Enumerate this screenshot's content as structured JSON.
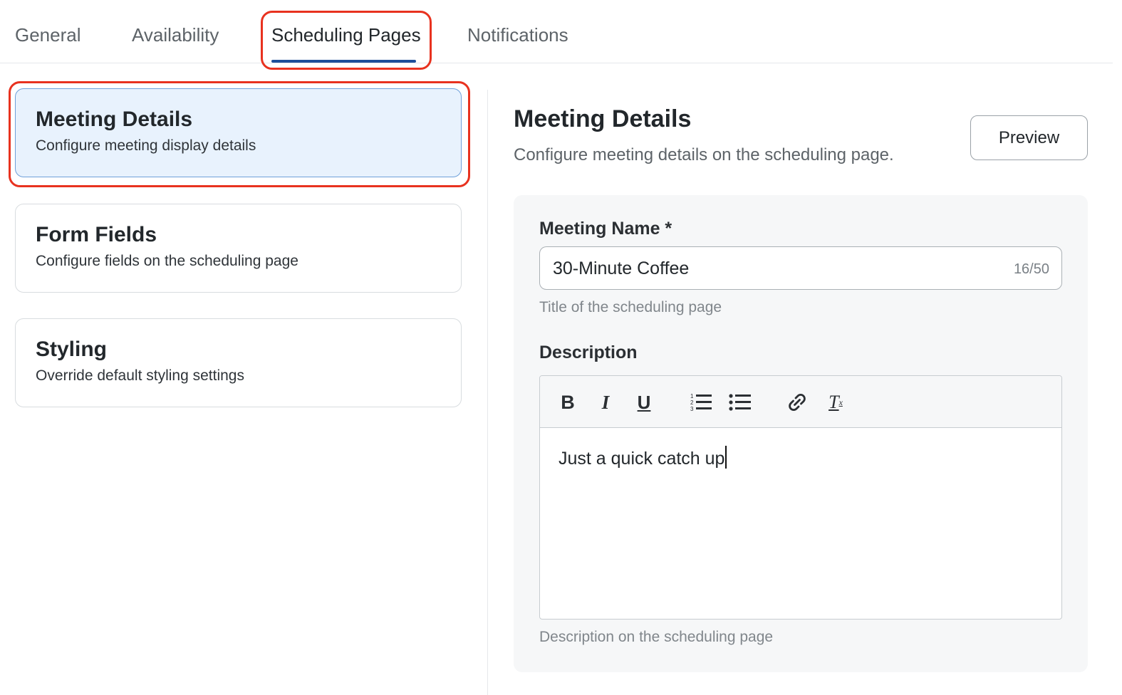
{
  "tabs": [
    {
      "label": "General",
      "active": false
    },
    {
      "label": "Availability",
      "active": false
    },
    {
      "label": "Scheduling Pages",
      "active": true
    },
    {
      "label": "Notifications",
      "active": false
    }
  ],
  "sections": [
    {
      "title": "Meeting Details",
      "subtitle": "Configure meeting display details",
      "selected": true
    },
    {
      "title": "Form Fields",
      "subtitle": "Configure fields on the scheduling page",
      "selected": false
    },
    {
      "title": "Styling",
      "subtitle": "Override default styling settings",
      "selected": false
    }
  ],
  "main": {
    "title": "Meeting Details",
    "subtitle": "Configure meeting details on the scheduling page.",
    "preview_label": "Preview",
    "meeting_name": {
      "label": "Meeting Name *",
      "value": "30-Minute Coffee",
      "counter": "16/50",
      "helper": "Title of the scheduling page"
    },
    "description": {
      "label": "Description",
      "value": "Just a quick catch up",
      "helper": "Description on the scheduling page",
      "toolbar": {
        "bold": "B",
        "italic": "I",
        "underline": "U",
        "ordered_list": "ordered-list-icon",
        "bullet_list": "bullet-list-icon",
        "link": "link-icon",
        "clear_format": "T",
        "clear_format_sub": "x"
      }
    }
  },
  "colors": {
    "accent": "#1d4f9a",
    "highlight": "#e8321f",
    "selected_card_bg": "#e8f2fd"
  }
}
